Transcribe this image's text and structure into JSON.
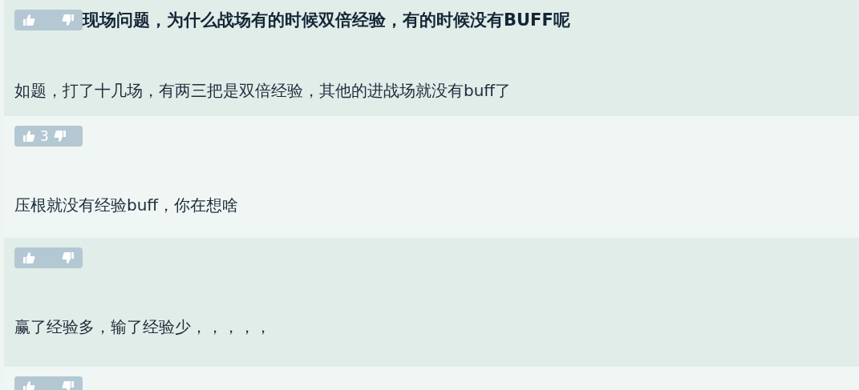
{
  "posts": [
    {
      "kind": "question",
      "title": "现场问题，为什么战场有的时候双倍经验，有的时候没有BUFF呢",
      "body": "如题，打了十几场，有两三把是双倍经验，其他的进战场就没有buff了"
    },
    {
      "kind": "reply",
      "score": "3",
      "body": "压根就没有经验buff，你在想啥"
    },
    {
      "kind": "reply",
      "body": "赢了经验多，输了经验少，，，，，"
    },
    {
      "kind": "stub"
    }
  ]
}
